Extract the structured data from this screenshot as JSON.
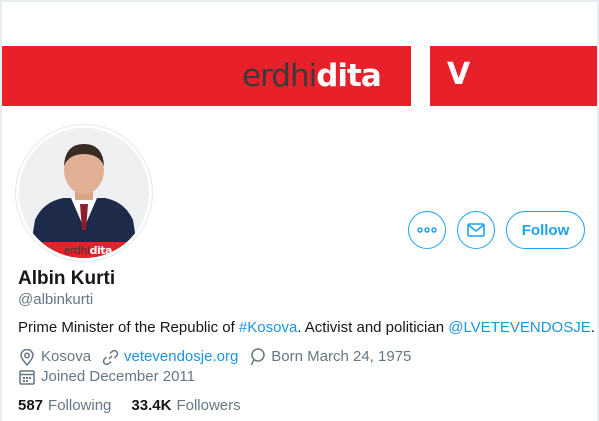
{
  "banner": {
    "logo_pre": "erdhi",
    "logo_post": "dita",
    "party_mark": "V",
    "brand_red": "#e8202a"
  },
  "avatar": {
    "watermark_pre": "erdhi",
    "watermark_post": "dita"
  },
  "actions": {
    "more_icon": "more-dots-icon",
    "message_icon": "envelope-icon",
    "follow_label": "Follow",
    "accent": "#1da1f2"
  },
  "profile": {
    "name": "Albin Kurti",
    "handle": "@albinkurti",
    "bio": {
      "part1": "Prime Minister of the Republic of ",
      "hashtag": "#Kosova",
      "part2": ". Activist and politician ",
      "mention": "@LVETEVENDOSJE",
      "part3": "."
    },
    "location": "Kosova",
    "website": "vetevendosje.org",
    "birthday": "Born March 24, 1975",
    "joined": "Joined December 2011"
  },
  "stats": {
    "following_count": "587",
    "following_label": "Following",
    "followers_count": "33.4K",
    "followers_label": "Followers"
  }
}
